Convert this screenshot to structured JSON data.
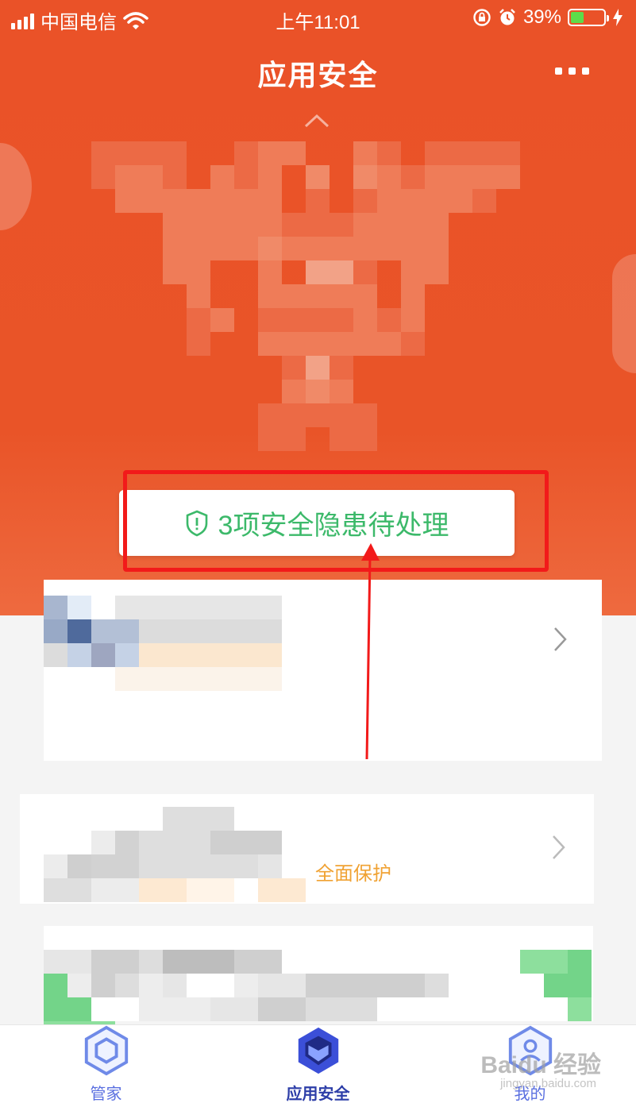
{
  "status_bar": {
    "carrier": "中国电信",
    "time": "上午11:01",
    "battery": "39%",
    "battery_level": 0.39
  },
  "nav": {
    "title": "应用安全",
    "more_icon": "more-dots-icon"
  },
  "alert": {
    "label": "3项安全隐患待处理",
    "icon": "shield-warning-icon",
    "color": "#3cb96a"
  },
  "cards": {
    "card2_promo": "全面保护"
  },
  "tabs": [
    {
      "label": "管家",
      "icon": "hexagon-ring-icon"
    },
    {
      "label": "应用安全",
      "icon": "hexagon-shield-icon"
    },
    {
      "label": "我的",
      "icon": "hexagon-user-icon"
    }
  ],
  "watermark": {
    "brand": "Baidu 经验",
    "url": "jingyan.baidu.com"
  },
  "colors": {
    "hero": "#ea5228",
    "highlight": "#f21a1a",
    "tab_active": "#2d3ea8"
  }
}
